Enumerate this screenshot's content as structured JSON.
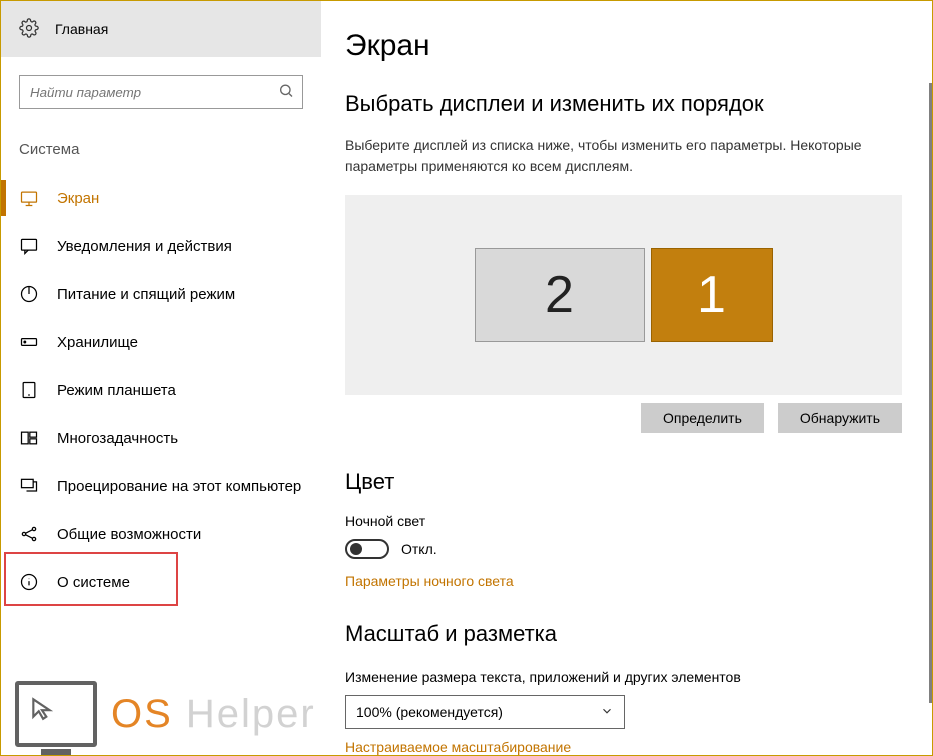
{
  "sidebar": {
    "home": "Главная",
    "search_placeholder": "Найти параметр",
    "section": "Система",
    "items": [
      {
        "label": "Экран"
      },
      {
        "label": "Уведомления и действия"
      },
      {
        "label": "Питание и спящий режим"
      },
      {
        "label": "Хранилище"
      },
      {
        "label": "Режим планшета"
      },
      {
        "label": "Многозадачность"
      },
      {
        "label": "Проецирование на этот компьютер"
      },
      {
        "label": "Общие возможности"
      },
      {
        "label": "О системе"
      }
    ]
  },
  "main": {
    "title": "Экран",
    "arrange_heading": "Выбрать дисплеи и изменить их порядок",
    "arrange_desc": "Выберите дисплей из списка ниже, чтобы изменить его параметры. Некоторые параметры применяются ко всем дисплеям.",
    "monitor2": "2",
    "monitor1": "1",
    "identify": "Определить",
    "detect": "Обнаружить",
    "color_heading": "Цвет",
    "night_light_label": "Ночной свет",
    "toggle_state": "Откл.",
    "night_light_link": "Параметры ночного света",
    "scale_heading": "Масштаб и разметка",
    "scale_label": "Изменение размера текста, приложений и других элементов",
    "scale_value": "100% (рекомендуется)",
    "custom_scale": "Настраиваемое масштабирование"
  },
  "watermark": {
    "brand1": "OS",
    "brand2": " Helper"
  }
}
